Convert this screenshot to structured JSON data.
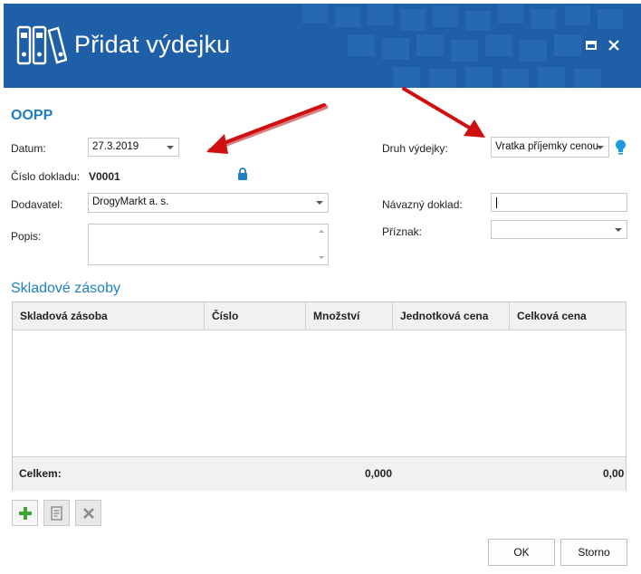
{
  "window": {
    "title": "Přidat výdejku",
    "header_color": "#1f5fa8",
    "icons": [
      "binders-icon",
      "maximize-icon",
      "close-icon"
    ]
  },
  "form": {
    "section_title": "OOPP",
    "datum": {
      "label": "Datum:",
      "value": "27.3.2019"
    },
    "cislo_dokladu": {
      "label": "Číslo dokladu:",
      "value": "V0001"
    },
    "dodavatel": {
      "label": "Dodavatel:",
      "value": "DrogyMarkt a. s."
    },
    "popis": {
      "label": "Popis:",
      "value": ""
    },
    "druh_vydejky": {
      "label": "Druh výdejky:",
      "value": "Vratka příjemky cenou"
    },
    "navazny_doklad": {
      "label": "Návazný doklad:",
      "value": ""
    },
    "priznak": {
      "label": "Příznak:",
      "value": ""
    }
  },
  "stock": {
    "section_title": "Skladové zásoby",
    "columns": [
      "Skladová zásoba",
      "Číslo",
      "Množství",
      "Jednotková cena",
      "Celková cena"
    ],
    "rows": [],
    "footer": {
      "label": "Celkem:",
      "quantity_total": "0,000",
      "price_total": "0,00"
    }
  },
  "toolbar": {
    "icons": [
      "add-icon",
      "edit-icon",
      "delete-icon"
    ]
  },
  "buttons": {
    "ok": "OK",
    "cancel": "Storno"
  },
  "colors": {
    "accent": "#1e7fc2",
    "arrow": "#d01010",
    "add_green": "#3aa82e"
  }
}
